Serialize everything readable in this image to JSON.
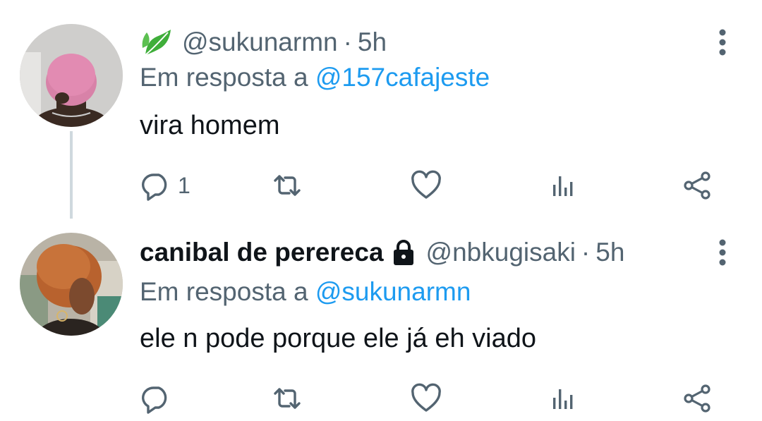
{
  "tweets": [
    {
      "display_name": "",
      "handle": "@sukunarmn",
      "separator": "·",
      "time": "5h",
      "reply_prefix": "Em resposta a",
      "reply_to": "@157cafajeste",
      "text": "vira homem",
      "reply_count": "1",
      "icons": [
        "leaf-icon",
        "more-vertical-icon",
        "reply-icon",
        "retweet-icon",
        "like-icon",
        "views-icon",
        "share-icon"
      ]
    },
    {
      "display_name": "canibal de perereca",
      "handle": "@nbkugisaki",
      "separator": "·",
      "time": "5h",
      "reply_prefix": "Em resposta a",
      "reply_to": "@sukunarmn",
      "text": "ele n pode porque ele já eh viado",
      "reply_count": "",
      "protected": true,
      "icons": [
        "lock-icon",
        "more-vertical-icon",
        "reply-icon",
        "retweet-icon",
        "like-icon",
        "views-icon",
        "share-icon"
      ]
    }
  ],
  "colors": {
    "text_primary": "#0f1419",
    "text_secondary": "#536471",
    "link": "#1d9bf0",
    "thread_line": "#cfd9de",
    "leaf_green": "#3fae3a"
  }
}
